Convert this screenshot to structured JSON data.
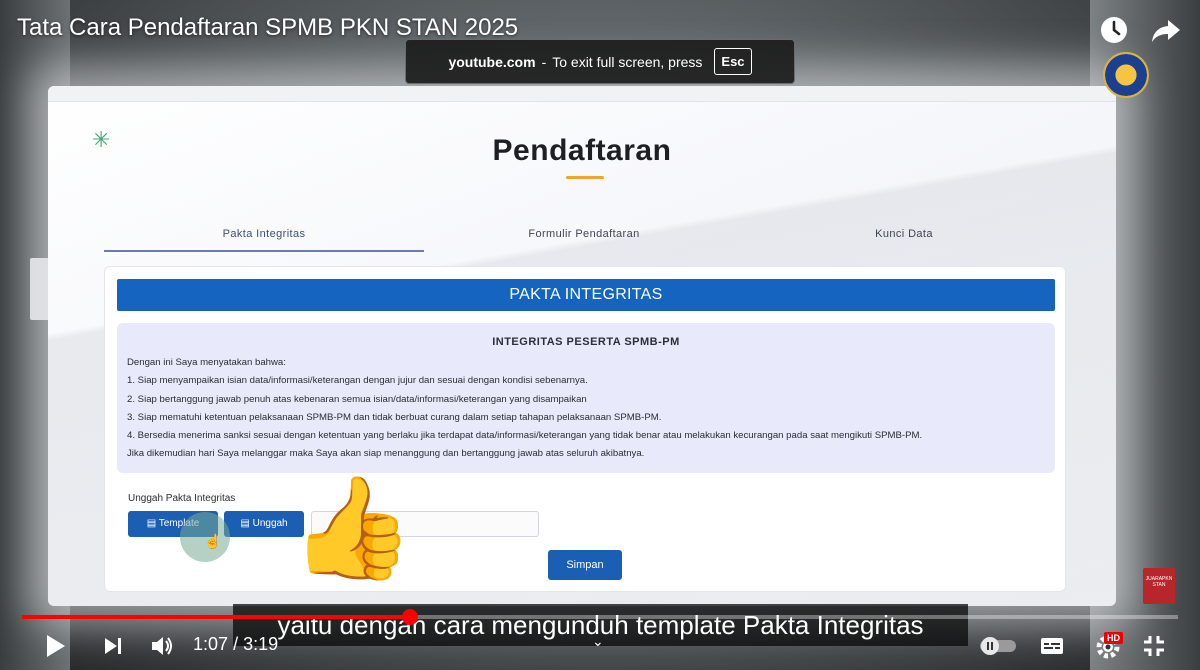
{
  "video": {
    "title": "Tata Cara Pendaftaran SPMB PKN STAN 2025",
    "current_time": "1:07",
    "separator": "/",
    "duration": "3:19",
    "progress_fraction": 0.336,
    "subtitle": "yaitu dengan cara mengunduh template Pakta Integritas",
    "hd_badge": "HD"
  },
  "fullscreen_notice": {
    "site": "youtube.com",
    "dash": "-",
    "message": "To exit full screen, press",
    "key": "Esc"
  },
  "channel_badge": "JUARAPKN STAN",
  "webpage": {
    "title": "Pendaftaran",
    "tabs": [
      "Pakta Integritas",
      "Formulir Pendaftaran",
      "Kunci Data"
    ],
    "active_tab_index": 0,
    "card_header": "PAKTA INTEGRITAS",
    "integrity": {
      "heading": "INTEGRITAS PESERTA SPMB-PM",
      "lines": [
        "Dengan ini Saya menyatakan bahwa:",
        "1. Siap menyampaikan isian data/informasi/keterangan dengan jujur dan sesuai dengan kondisi sebenarnya.",
        "2. Siap bertanggung jawab penuh atas kebenaran semua isian/data/informasi/keterangan yang disampaikan",
        "3. Siap mematuhi ketentuan pelaksanaan SPMB-PM dan tidak berbuat curang dalam setiap tahapan pelaksanaan SPMB-PM.",
        "4. Bersedia menerima sanksi sesuai dengan ketentuan yang berlaku jika terdapat data/informasi/keterangan yang tidak benar atau melakukan kecurangan pada saat mengikuti SPMB-PM.",
        "Jika dikemudian hari Saya melanggar maka Saya akan siap menanggung dan bertanggung jawab atas seluruh akibatnya."
      ]
    },
    "upload_label": "Unggah Pakta Integritas",
    "template_button": "Template",
    "upload_button": "Unggah",
    "file_input_value": "",
    "save_button": "Simpan"
  },
  "colors": {
    "primary_blue": "#1565c0",
    "button_blue": "#1a5fb4",
    "accent_orange": "#f0a429",
    "progress_red": "#ff0000",
    "integrity_bg": "#e8e9fb"
  },
  "icons": {
    "emoji": "👍"
  }
}
